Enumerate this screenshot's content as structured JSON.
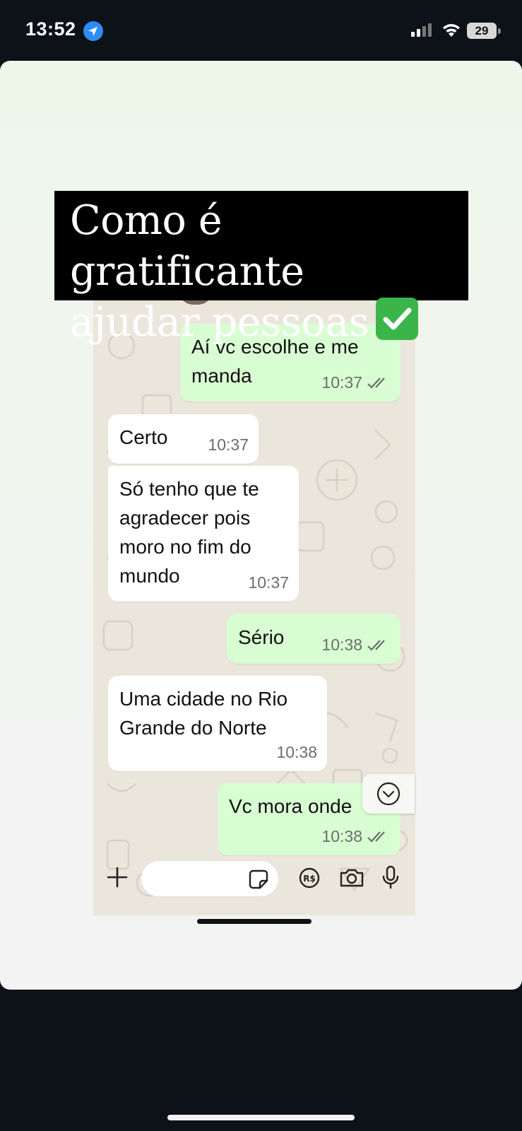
{
  "status_bar": {
    "time": "13:52",
    "battery": "29"
  },
  "caption": {
    "line1": "Como é gratificante",
    "line2": "ajudar pessoas"
  },
  "messages": [
    {
      "text": "Aí vc escolhe e me manda",
      "time": "10:37",
      "direction": "out"
    },
    {
      "text": "Certo",
      "time": "10:37",
      "direction": "in"
    },
    {
      "text": "Só tenho que te agradecer pois moro no fim do mundo",
      "time": "10:37",
      "direction": "in"
    },
    {
      "text": "Sério",
      "time": "10:38",
      "direction": "out"
    },
    {
      "text": "Uma cidade no Rio Grande do Norte",
      "time": "10:38",
      "direction": "in"
    },
    {
      "text": "Vc mora onde",
      "time": "10:38",
      "direction": "out"
    }
  ],
  "icons": {
    "location": "location-arrow-icon",
    "signal": "cell-signal-icon",
    "wifi": "wifi-icon",
    "check": "check-mark-button-icon",
    "scroll_down": "chevron-down-icon",
    "plus": "plus-icon",
    "sticker": "sticker-icon",
    "pix": "pix-payment-icon",
    "camera": "camera-icon",
    "mic": "microphone-icon"
  },
  "colors": {
    "outgoing_bubble": "#d9fdd3",
    "incoming_bubble": "#ffffff",
    "chat_background": "#ebe6dc",
    "location_blue": "#2f8cf5"
  }
}
